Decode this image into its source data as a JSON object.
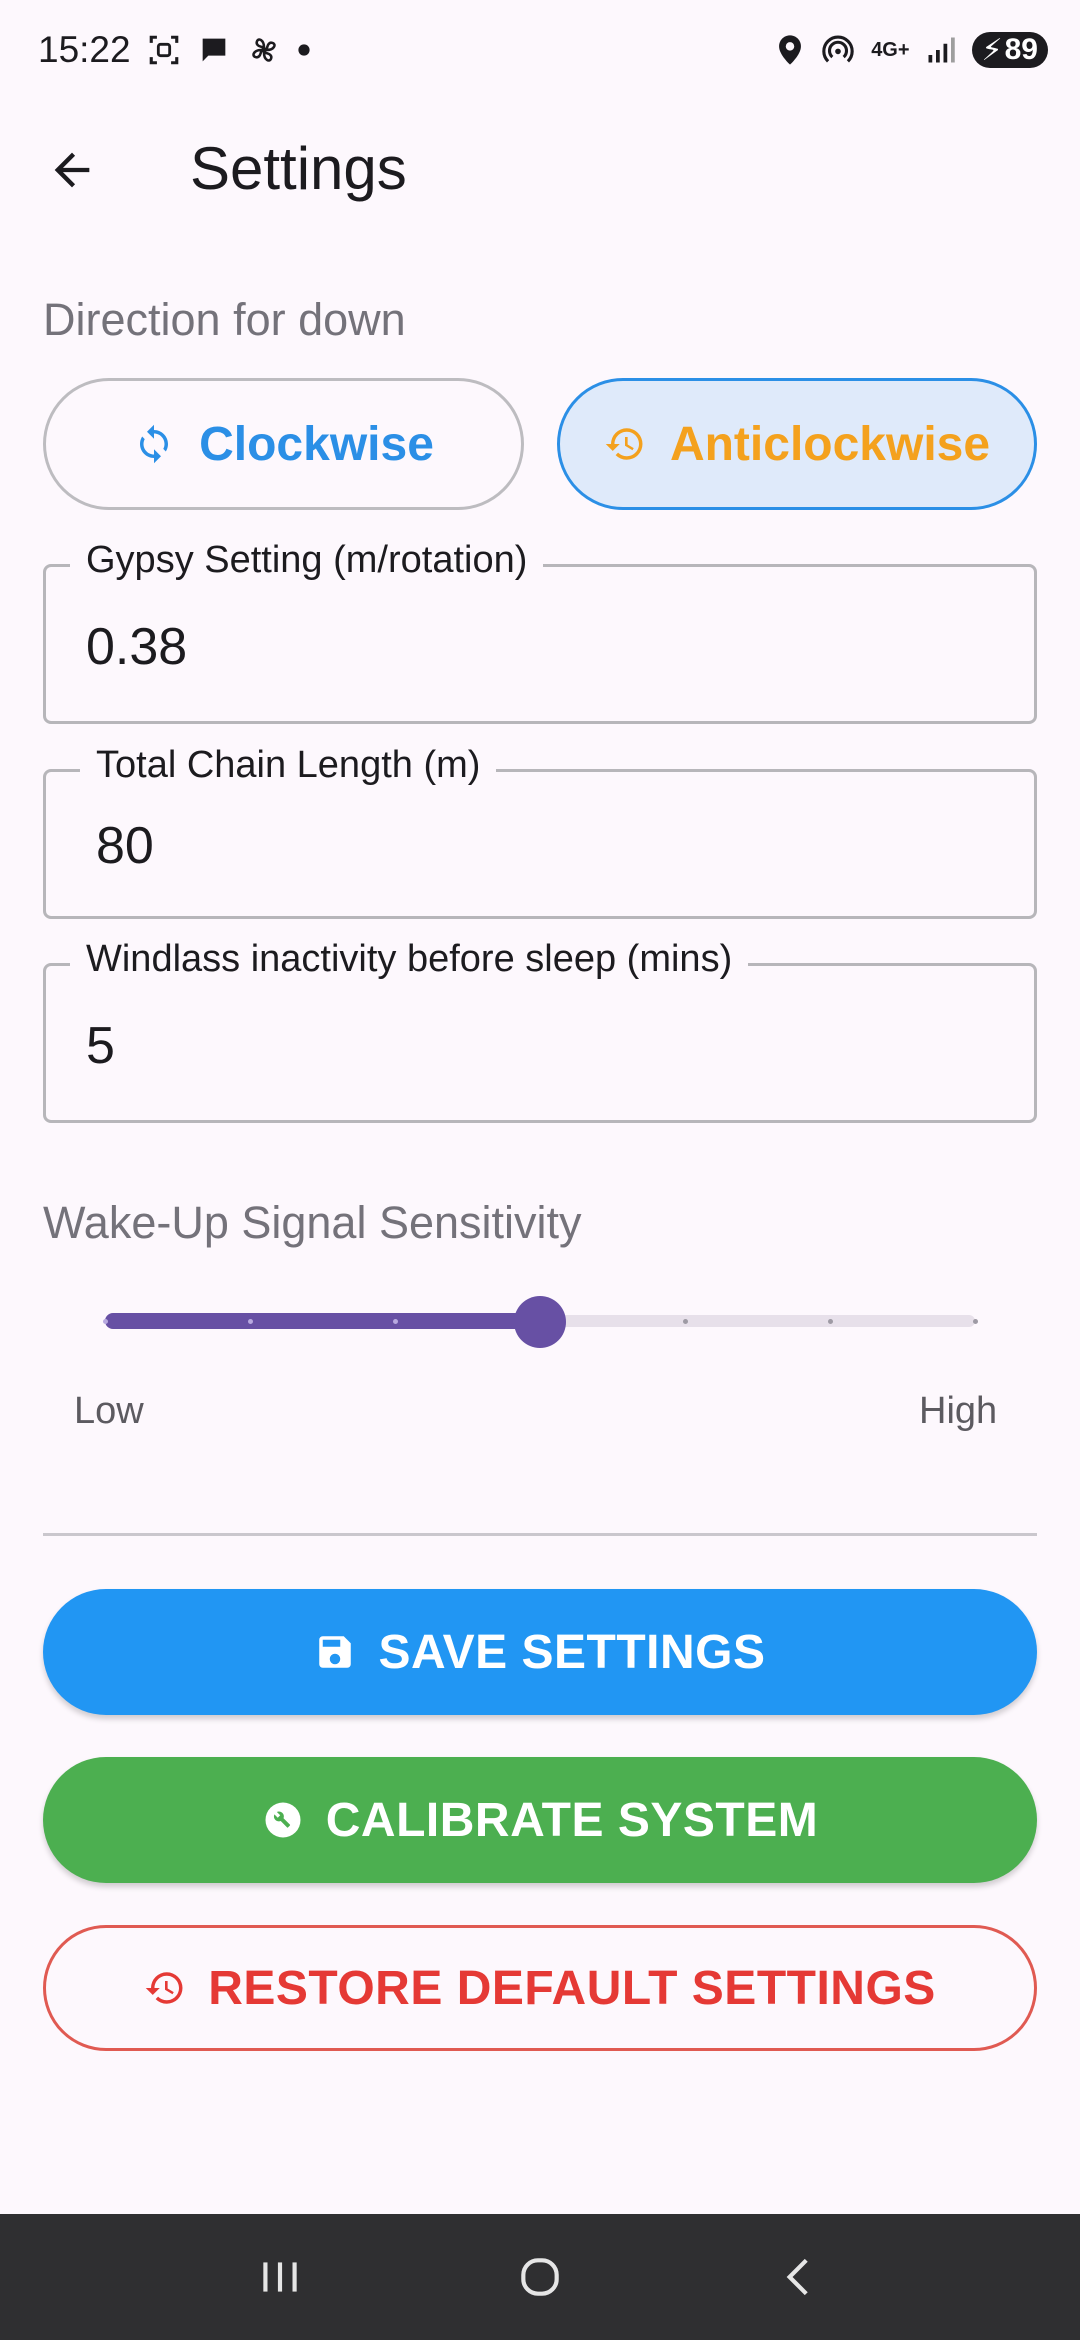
{
  "status_bar": {
    "time": "15:22",
    "network_label": "4G+",
    "battery": "89"
  },
  "app_bar": {
    "title": "Settings"
  },
  "direction": {
    "label": "Direction for down",
    "clockwise_label": "Clockwise",
    "anticlockwise_label": "Anticlockwise",
    "selected": "Anticlockwise"
  },
  "fields": {
    "gypsy": {
      "label": "Gypsy Setting (m/rotation)",
      "value": "0.38"
    },
    "chain": {
      "label": "Total Chain Length (m)",
      "value": "80"
    },
    "sleep": {
      "label": "Windlass inactivity before sleep (mins)",
      "value": "5"
    }
  },
  "sensitivity": {
    "label": "Wake-Up Signal Sensitivity",
    "low_label": "Low",
    "high_label": "High",
    "steps": 6,
    "value_step": 3
  },
  "actions": {
    "save_label": "SAVE SETTINGS",
    "calibrate_label": "CALIBRATE SYSTEM",
    "restore_label": "RESTORE DEFAULT SETTINGS"
  },
  "colors": {
    "primary_blue": "#2196f3",
    "anticlockwise_orange": "#f4a11d",
    "calibrate_green": "#4caf50",
    "restore_red": "#e53935",
    "slider_purple": "#6750a4"
  }
}
